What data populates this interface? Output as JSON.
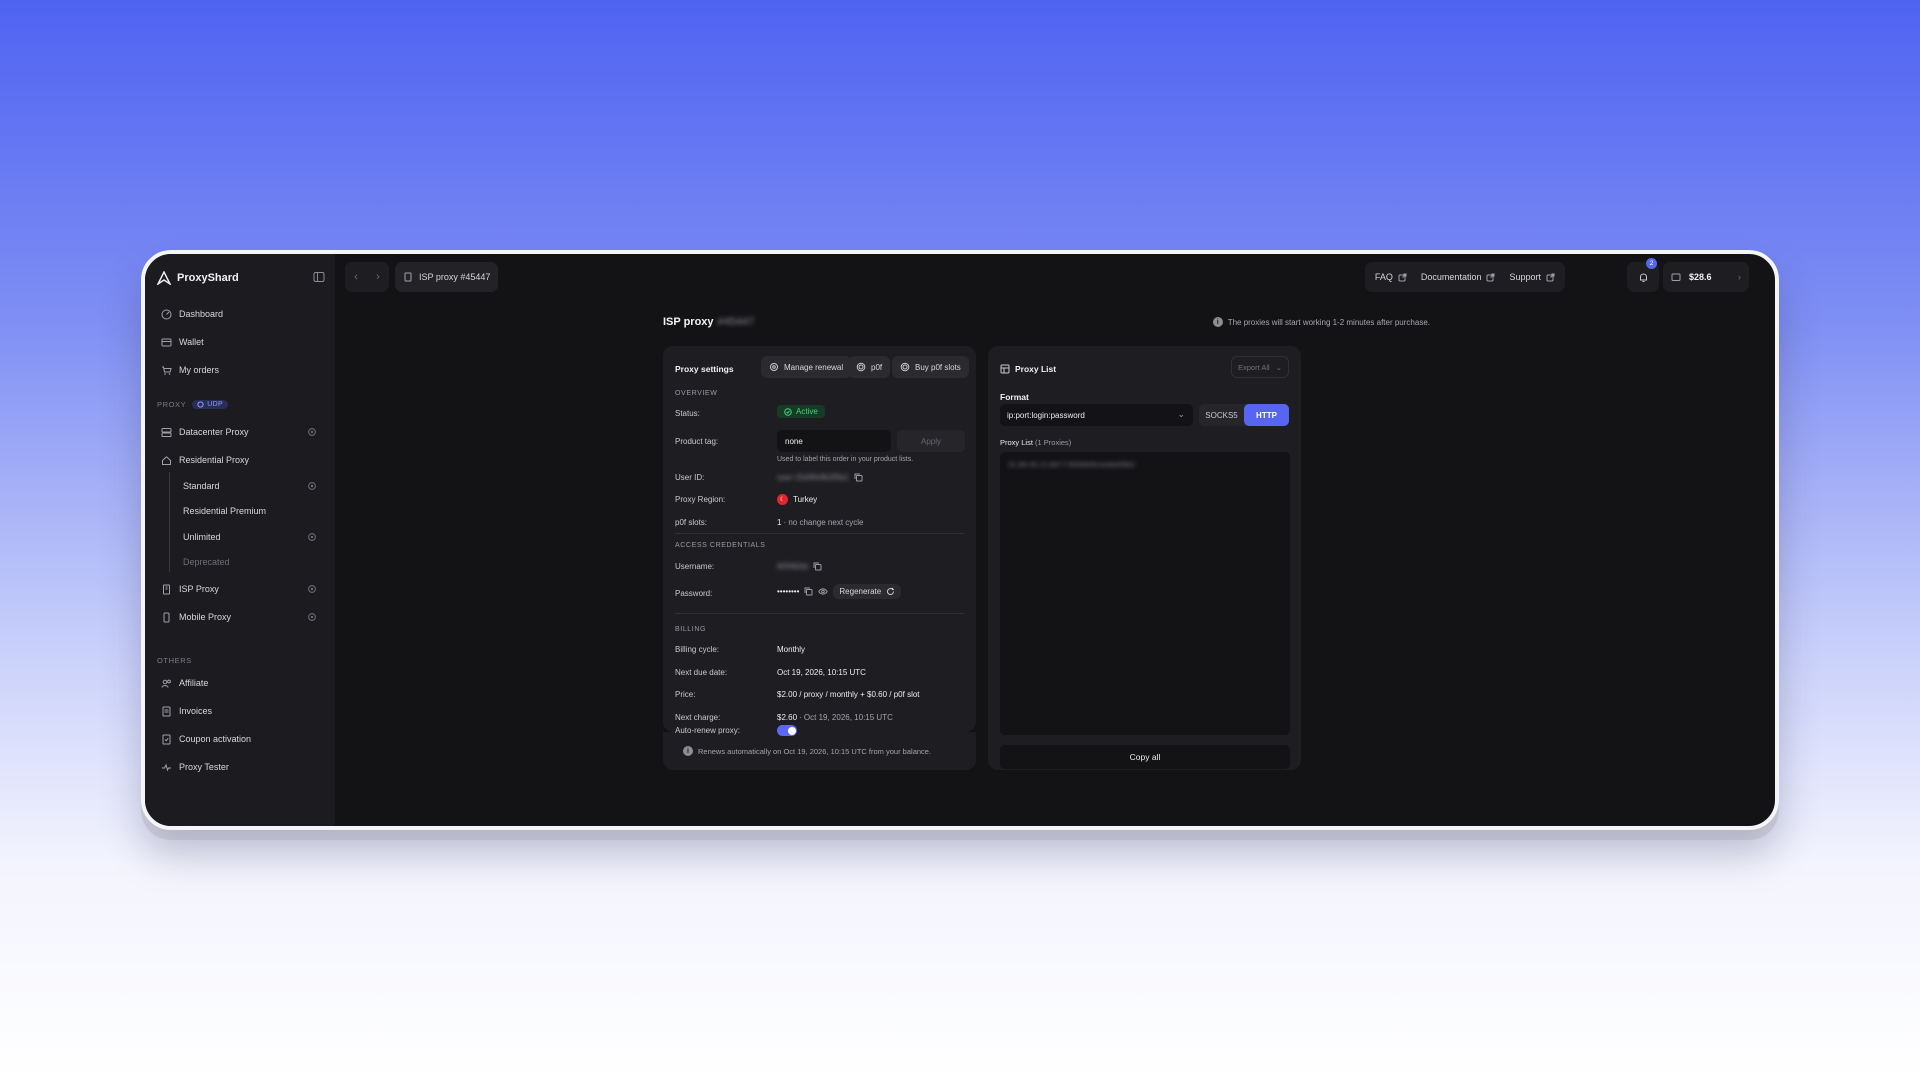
{
  "brand": {
    "name": "ProxyShard"
  },
  "sidebar": {
    "main_items": [
      {
        "label": "Dashboard",
        "icon": "dashboard-icon"
      },
      {
        "label": "Wallet",
        "icon": "wallet-icon"
      },
      {
        "label": "My orders",
        "icon": "cart-icon"
      }
    ],
    "proxy_section_label": "PROXY",
    "udp_badge": "UDP",
    "proxy_items": [
      {
        "label": "Datacenter Proxy",
        "icon": "server-icon",
        "settings": true
      },
      {
        "label": "Residential Proxy",
        "icon": "home-icon",
        "settings": false
      },
      {
        "label": "Standard",
        "settings": true
      },
      {
        "label": "Residential Premium",
        "settings": false
      },
      {
        "label": "Unlimited",
        "settings": true
      },
      {
        "label": "Deprecated",
        "settings": false
      },
      {
        "label": "ISP Proxy",
        "icon": "building-icon",
        "settings": true
      },
      {
        "label": "Mobile Proxy",
        "icon": "phone-icon",
        "settings": true
      }
    ],
    "others_section_label": "OTHERS",
    "other_items": [
      {
        "label": "Affiliate",
        "icon": "users-icon"
      },
      {
        "label": "Invoices",
        "icon": "invoice-icon"
      },
      {
        "label": "Coupon activation",
        "icon": "coupon-icon"
      },
      {
        "label": "Proxy Tester",
        "icon": "pulse-icon"
      }
    ]
  },
  "topbar": {
    "tab_label": "ISP proxy #45447",
    "links": [
      "FAQ",
      "Documentation",
      "Support"
    ],
    "notification_count": "2",
    "balance": "$28.6"
  },
  "page": {
    "title": "ISP proxy",
    "title_suffix": "#45447",
    "info_note": "The proxies will start working 1-2 minutes after purchase."
  },
  "settings": {
    "title": "Proxy settings",
    "buttons": [
      "Manage renewal",
      "p0f",
      "Buy p0f slots"
    ],
    "overview_label": "OVERVIEW",
    "status_label": "Status:",
    "status_value": "Active",
    "product_tag_label": "Product tag:",
    "product_tag_value": "none",
    "apply_label": "Apply",
    "product_tag_helper": "Used to label this order in your product lists.",
    "user_id_label": "User ID:",
    "user_id_value": "user-15d9fe9b2f5b1",
    "region_label": "Proxy Region:",
    "region_value": "Turkey",
    "p0f_slots_label": "p0f slots:",
    "p0f_slots_value": "1",
    "p0f_slots_note": "· no change next cycle",
    "access_label": "ACCESS CREDENTIALS",
    "username_label": "Username:",
    "username_value": "8f3f4b5b",
    "password_label": "Password:",
    "password_value": "••••••••",
    "regenerate_label": "Regenerate",
    "billing_label": "BILLING",
    "billing_cycle_label": "Billing cycle:",
    "billing_cycle_value": "Monthly",
    "next_due_label": "Next due date:",
    "next_due_value": "Oct 19, 2026, 10:15 UTC",
    "price_label": "Price:",
    "price_value": "$2.00 / proxy / monthly + $0.60 / p0f slot",
    "next_charge_label": "Next charge:",
    "next_charge_value": "$2.60",
    "next_charge_note": "· Oct 19, 2026, 10:15 UTC",
    "auto_renew_label": "Auto-renew proxy:",
    "auto_renew_on": true,
    "renew_note": "Renews automatically on Oct 19, 2026, 10:15 UTC from your balance."
  },
  "proxy_list": {
    "title": "Proxy List",
    "export_label": "Export All",
    "format_label": "Format",
    "format_value": "ip:port:login:password",
    "protocols": [
      "SOCKS5",
      "HTTP"
    ],
    "active_protocol": "HTTP",
    "list_label": "Proxy List",
    "list_count": "(1 Proxies)",
    "entries": [
      "31.88.45.21:8977:8f3f4b5b:b4de6f9b2"
    ],
    "copy_all_label": "Copy all"
  },
  "colors": {
    "accent": "#5765f0",
    "active_green": "#3fd37d",
    "window_bg": "#131316",
    "panel_bg": "#1e1e22"
  }
}
